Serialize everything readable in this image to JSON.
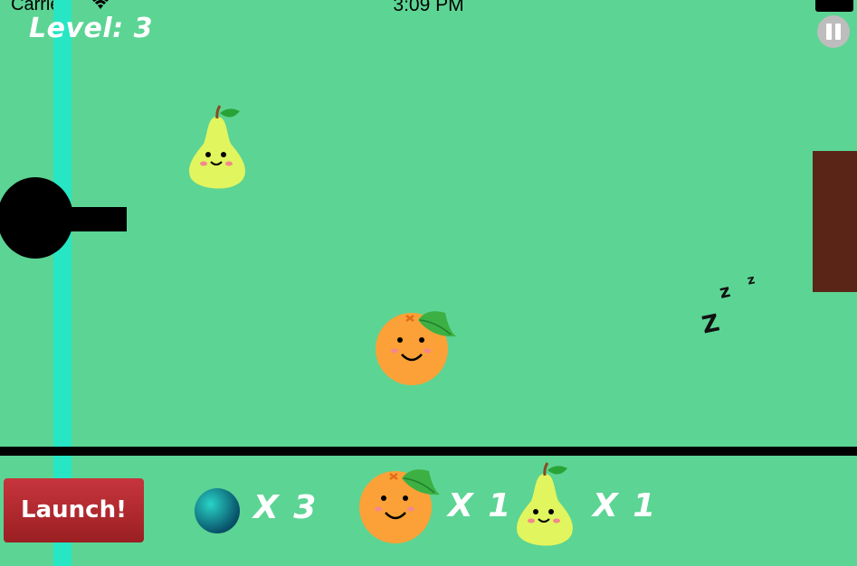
{
  "status_bar": {
    "carrier": "Carrier",
    "time": "3:09 PM"
  },
  "hud": {
    "level_label": "Level: 3"
  },
  "controls": {
    "launch_label": "Launch!"
  },
  "inventory": {
    "balls_count": "X 3",
    "oranges_count": "X 1",
    "pears_count": "X 1"
  },
  "sleep_text": {
    "z_large": "Z",
    "z_medium": "z",
    "z_small": "z"
  },
  "colors": {
    "background": "#5cd494",
    "rail": "#27e6c4",
    "brick": "#5a2416",
    "launch_button": "#b5262e"
  },
  "icons": [
    "wifi-icon",
    "battery-icon",
    "pause-icon",
    "cannon",
    "pear-character",
    "orange-character",
    "ball-icon"
  ]
}
